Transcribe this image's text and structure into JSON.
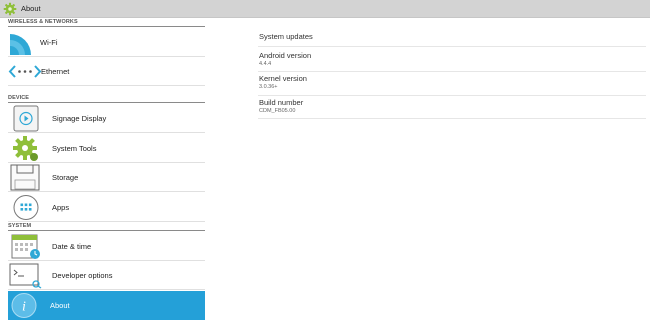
{
  "window": {
    "title": "About",
    "icon": "settings-gear-icon"
  },
  "sidebar": {
    "sections": [
      {
        "header": "WIRELESS & NETWORKS"
      },
      {
        "header": "DEVICE"
      },
      {
        "header": "SYSTEM"
      }
    ],
    "items": [
      {
        "label": "Wi-Fi",
        "icon": "wifi-icon"
      },
      {
        "label": "Ethernet",
        "icon": "ethernet-icon"
      },
      {
        "label": "Signage Display",
        "icon": "signage-display-icon"
      },
      {
        "label": "System Tools",
        "icon": "system-tools-icon"
      },
      {
        "label": "Storage",
        "icon": "storage-icon"
      },
      {
        "label": "Apps",
        "icon": "apps-icon"
      },
      {
        "label": "Date & time",
        "icon": "date-time-icon"
      },
      {
        "label": "Developer options",
        "icon": "developer-options-icon"
      },
      {
        "label": "About",
        "icon": "about-icon",
        "selected": true
      }
    ]
  },
  "main": {
    "rows": [
      {
        "title": "System updates",
        "value": ""
      },
      {
        "title": "Android version",
        "value": "4.4.4"
      },
      {
        "title": "Kernel version",
        "value": "3.0.36+"
      },
      {
        "title": "Build number",
        "value": "CDM_FB05.00"
      }
    ]
  },
  "colors": {
    "accent": "#24a0d8",
    "titlebar": "#d3d3d3"
  }
}
